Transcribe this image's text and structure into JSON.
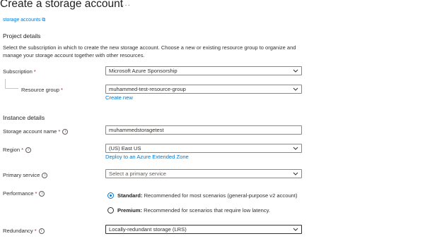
{
  "page": {
    "title": "Create a storage account",
    "more_label": "···",
    "cut_link": "storage accounts ⧉"
  },
  "project": {
    "heading": "Project details",
    "description": "Select the subscription in which to create the new storage account. Choose a new or existing resource group to organize and manage your storage account together with other resources.",
    "subscription_label": "Subscription",
    "subscription_value": "Microsoft Azure Sponsorship",
    "resource_group_label": "Resource group",
    "resource_group_value": "muhammed-test-resource-group",
    "create_new_link": "Create new"
  },
  "instance": {
    "heading": "Instance details",
    "name_label": "Storage account name",
    "name_value": "muhammedstoragetest",
    "region_label": "Region",
    "region_value": "(US) East US",
    "extended_zone_link": "Deploy to an Azure Extended Zone",
    "primary_service_label": "Primary service",
    "primary_service_placeholder": "Select a primary service",
    "performance_label": "Performance",
    "performance_options": [
      {
        "title": "Standard:",
        "text": "Recommended for most scenarios (general-purpose v2 account)",
        "selected": true
      },
      {
        "title": "Premium:",
        "text": "Recommended for scenarios that require low latency.",
        "selected": false
      }
    ],
    "redundancy_label": "Redundancy",
    "redundancy_value": "Locally-redundant storage (LRS)"
  },
  "common": {
    "required_mark": "*",
    "info_glyph": "i"
  },
  "colors": {
    "accent": "#0078d4",
    "required": "#a4262c",
    "border": "#8a8886",
    "text": "#323130"
  }
}
